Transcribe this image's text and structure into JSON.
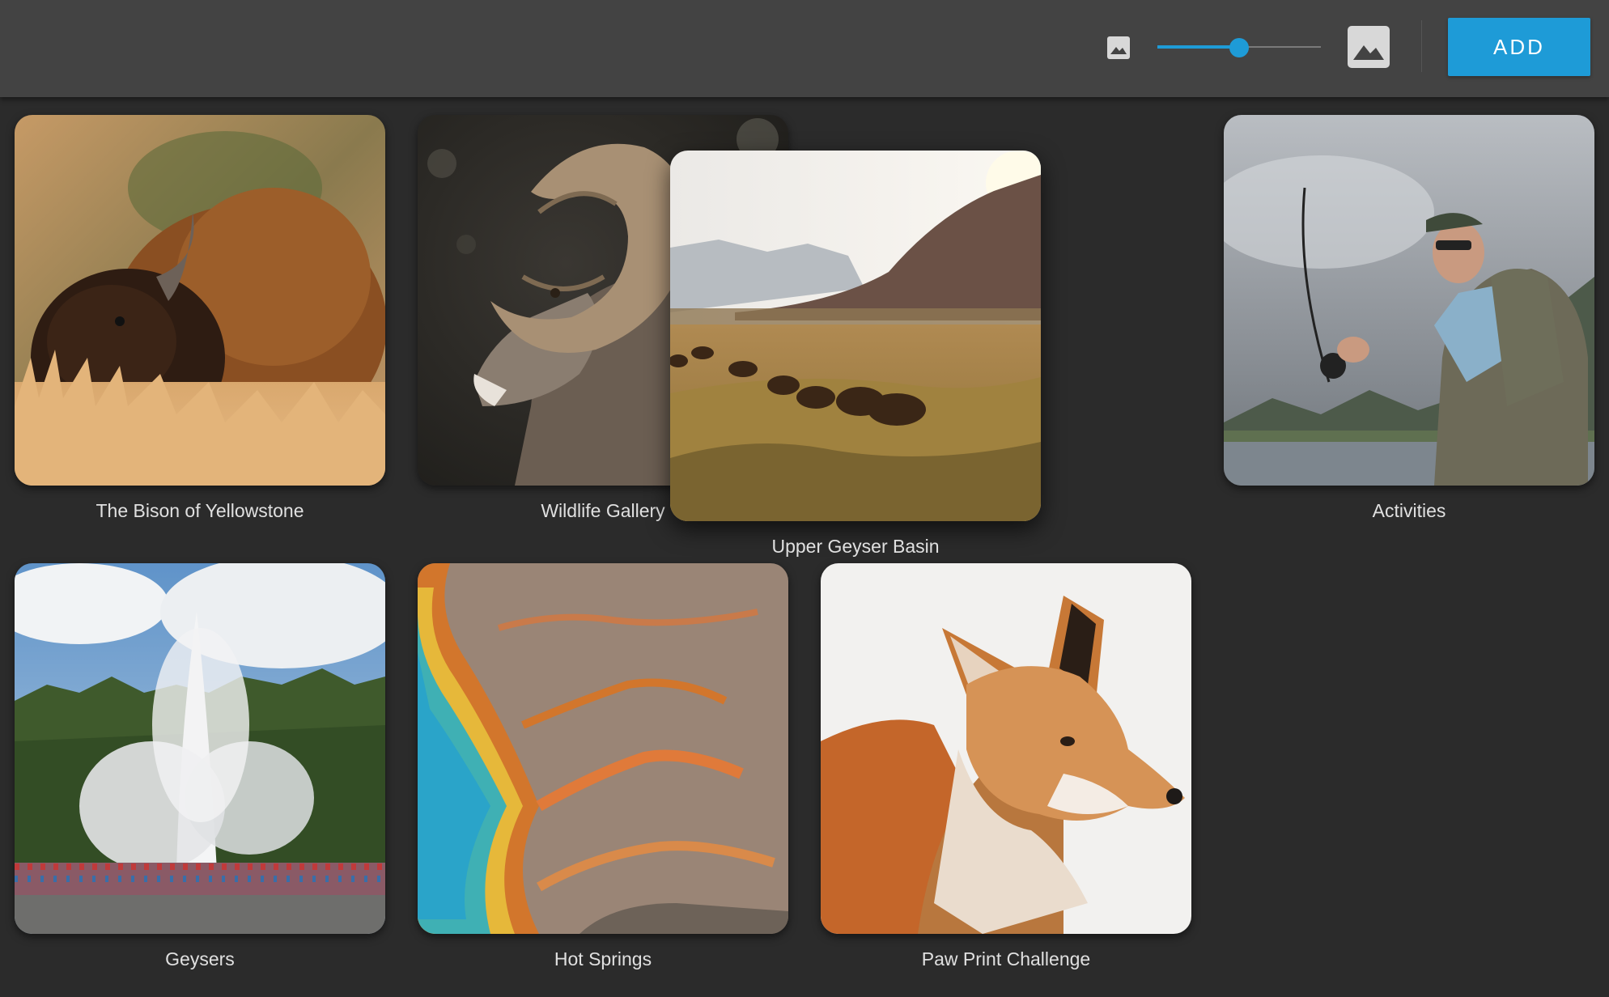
{
  "toolbar": {
    "small_size_icon": "image-small-icon",
    "large_size_icon": "image-large-icon",
    "size_slider_value": 0.5,
    "add_label": "ADD"
  },
  "colors": {
    "accent": "#1e9bd7",
    "background": "#2b2b2b",
    "toolbar": "#434343"
  },
  "gallery": {
    "items": [
      {
        "title": "The Bison of Yellowstone",
        "image": "bison-photo"
      },
      {
        "title": "Wildlife Gallery",
        "image": "bighorn-sheep-photo"
      },
      {
        "title": "Upper Geyser Basin",
        "image": "bison-valley-photo"
      },
      {
        "title": "Activities",
        "image": "fly-fishing-photo"
      },
      {
        "title": "Geysers",
        "image": "geyser-photo"
      },
      {
        "title": "Hot Springs",
        "image": "hot-spring-photo"
      },
      {
        "title": "Paw Print Challenge",
        "image": "fox-photo"
      }
    ]
  }
}
